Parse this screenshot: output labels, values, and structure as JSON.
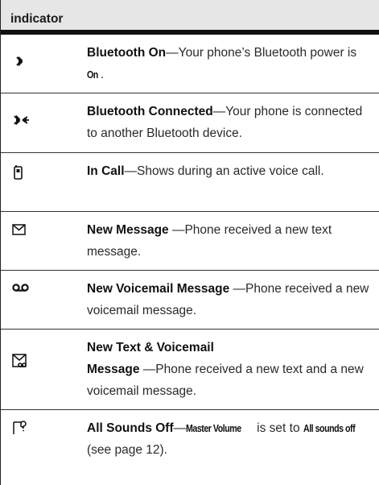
{
  "table": {
    "header": "indicator",
    "rows": [
      {
        "icon": "bluetooth-icon",
        "term": "Bluetooth On",
        "text_before": "—Your phone’s Bluetooth power is ",
        "keyword": "On",
        "text_after": "."
      },
      {
        "icon": "bluetooth-connected-icon",
        "term": "Bluetooth Connected",
        "text": "—Your phone is connected to another Bluetooth device."
      },
      {
        "icon": "in-call-icon",
        "term": "In Call",
        "text": "—Shows during an active voice call."
      },
      {
        "icon": "new-message-envelope-icon",
        "term": "New Message ",
        "text": "—Phone received a new text message."
      },
      {
        "icon": "voicemail-icon",
        "term": "New Voicemail Message ",
        "text": "—Phone received a new voicemail message."
      },
      {
        "icon": "text-and-voicemail-icon",
        "term_line1": "New Text & Voicemail",
        "term_line2": "Message ",
        "text": "—Phone received a new text and a new voicemail message."
      },
      {
        "icon": "sounds-off-icon",
        "term": "All Sounds Off",
        "dash": "—",
        "keyword1": "Master Volume",
        "mid": " is set to ",
        "keyword2": "All sounds off",
        "text_after": " (see page 12)."
      }
    ]
  }
}
